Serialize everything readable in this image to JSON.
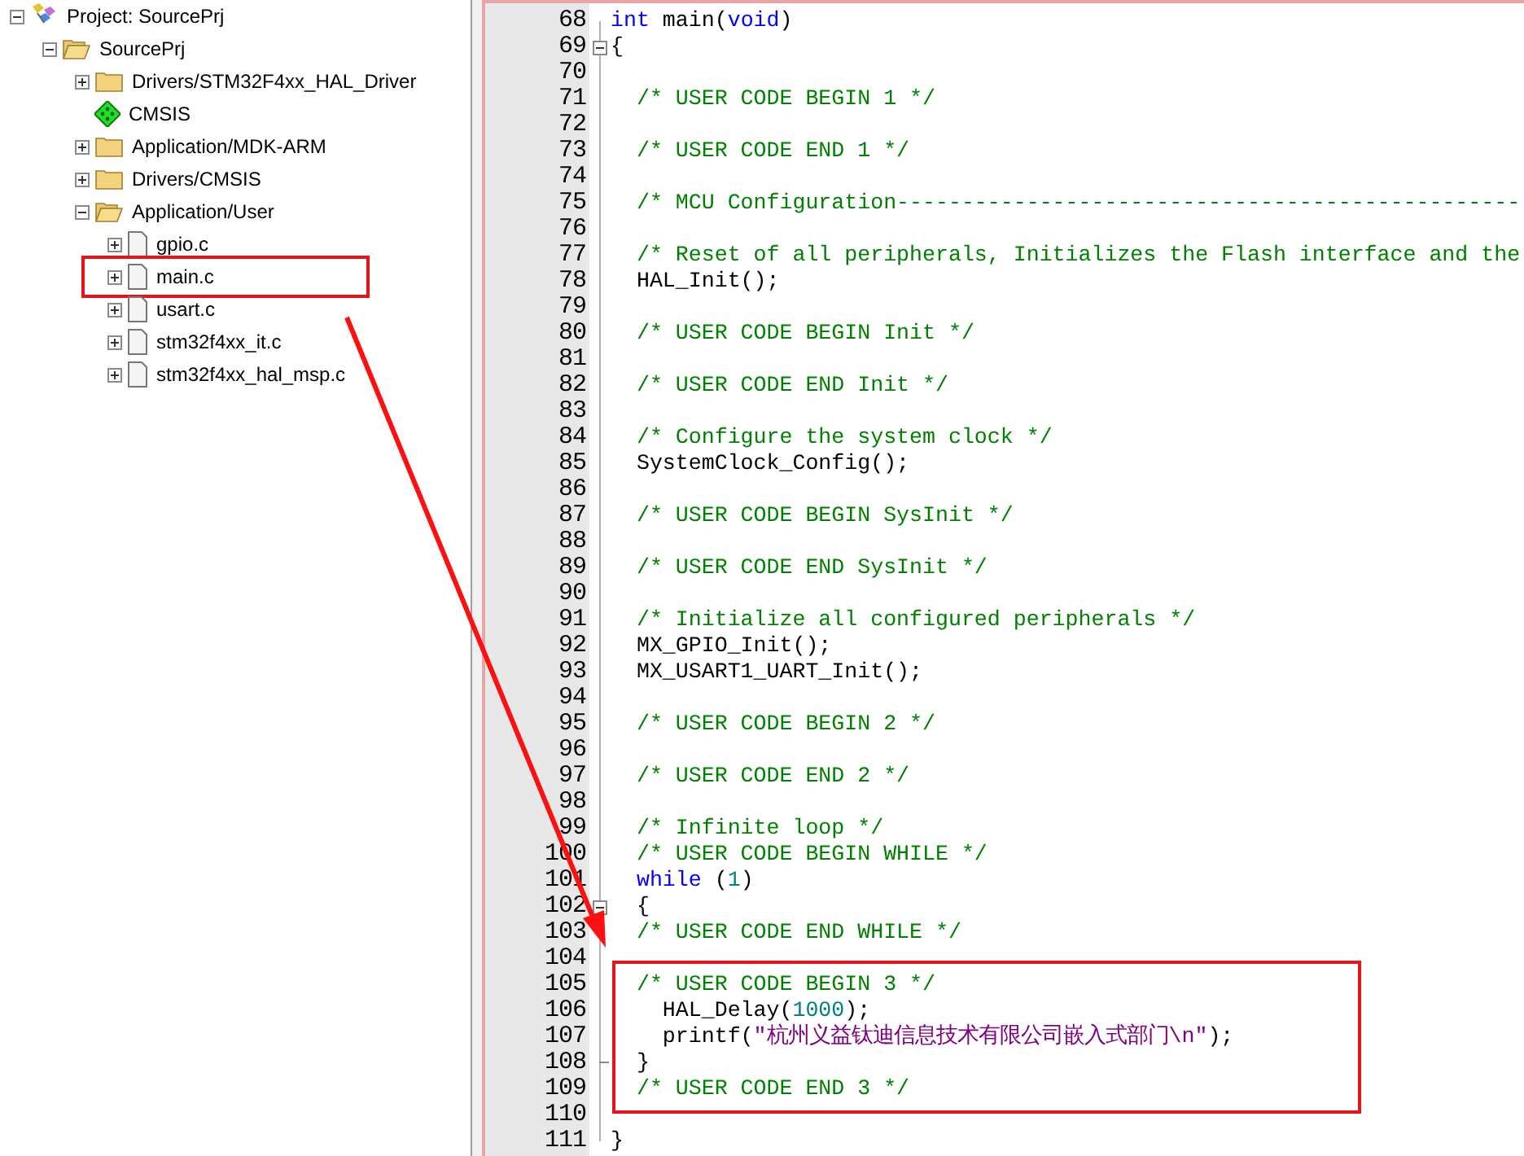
{
  "project_tree": [
    {
      "kind": "project",
      "label": "Project: SourcePrj",
      "expanded": true,
      "children": [
        {
          "kind": "target",
          "label": "SourcePrj",
          "expanded": true,
          "children": [
            {
              "kind": "folder",
              "label": "Drivers/STM32F4xx_HAL_Driver",
              "expanded": false
            },
            {
              "kind": "component",
              "label": "CMSIS"
            },
            {
              "kind": "folder",
              "label": "Application/MDK-ARM",
              "expanded": false
            },
            {
              "kind": "folder",
              "label": "Drivers/CMSIS",
              "expanded": false
            },
            {
              "kind": "folder",
              "label": "Application/User",
              "expanded": true,
              "children": [
                {
                  "kind": "file",
                  "label": "gpio.c",
                  "expanded": false,
                  "highlighted": false
                },
                {
                  "kind": "file",
                  "label": "main.c",
                  "expanded": false,
                  "highlighted": true
                },
                {
                  "kind": "file",
                  "label": "usart.c",
                  "expanded": false,
                  "highlighted": false
                },
                {
                  "kind": "file",
                  "label": "stm32f4xx_it.c",
                  "expanded": false,
                  "highlighted": false
                },
                {
                  "kind": "file",
                  "label": "stm32f4xx_hal_msp.c",
                  "expanded": false,
                  "highlighted": false
                }
              ]
            }
          ]
        }
      ]
    }
  ],
  "editor": {
    "arrow": true,
    "lines": [
      {
        "number": "68",
        "tokens": [
          {
            "kind": "keyword",
            "text": "int"
          },
          {
            "kind": "plain",
            "text": " main("
          },
          {
            "kind": "keyword",
            "text": "void"
          },
          {
            "kind": "plain",
            "text": ")"
          }
        ]
      },
      {
        "number": "69",
        "fold_start": true,
        "tokens": [
          {
            "kind": "plain",
            "text": "{"
          }
        ]
      },
      {
        "number": "70"
      },
      {
        "number": "71",
        "tokens": [
          {
            "kind": "comment",
            "text": "  /* USER CODE BEGIN 1 */"
          }
        ]
      },
      {
        "number": "72"
      },
      {
        "number": "73",
        "tokens": [
          {
            "kind": "comment",
            "text": "  /* USER CODE END 1 */"
          }
        ]
      },
      {
        "number": "74"
      },
      {
        "number": "75",
        "tokens": [
          {
            "kind": "comment",
            "text": "  /* MCU Configuration------------------------------------------------"
          }
        ]
      },
      {
        "number": "76"
      },
      {
        "number": "77",
        "tokens": [
          {
            "kind": "comment",
            "text": "  /* Reset of all peripherals, Initializes the Flash interface and the"
          }
        ]
      },
      {
        "number": "78",
        "tokens": [
          {
            "kind": "plain",
            "text": "  HAL_Init();"
          }
        ]
      },
      {
        "number": "79"
      },
      {
        "number": "80",
        "tokens": [
          {
            "kind": "comment",
            "text": "  /* USER CODE BEGIN Init */"
          }
        ]
      },
      {
        "number": "81"
      },
      {
        "number": "82",
        "tokens": [
          {
            "kind": "comment",
            "text": "  /* USER CODE END Init */"
          }
        ]
      },
      {
        "number": "83"
      },
      {
        "number": "84",
        "tokens": [
          {
            "kind": "comment",
            "text": "  /* Configure the system clock */"
          }
        ]
      },
      {
        "number": "85",
        "tokens": [
          {
            "kind": "plain",
            "text": "  SystemClock_Config();"
          }
        ]
      },
      {
        "number": "86"
      },
      {
        "number": "87",
        "tokens": [
          {
            "kind": "comment",
            "text": "  /* USER CODE BEGIN SysInit */"
          }
        ]
      },
      {
        "number": "88"
      },
      {
        "number": "89",
        "tokens": [
          {
            "kind": "comment",
            "text": "  /* USER CODE END SysInit */"
          }
        ]
      },
      {
        "number": "90"
      },
      {
        "number": "91",
        "tokens": [
          {
            "kind": "comment",
            "text": "  /* Initialize all configured peripherals */"
          }
        ]
      },
      {
        "number": "92",
        "tokens": [
          {
            "kind": "plain",
            "text": "  MX_GPIO_Init();"
          }
        ]
      },
      {
        "number": "93",
        "tokens": [
          {
            "kind": "plain",
            "text": "  MX_USART1_UART_Init();"
          }
        ]
      },
      {
        "number": "94"
      },
      {
        "number": "95",
        "tokens": [
          {
            "kind": "comment",
            "text": "  /* USER CODE BEGIN 2 */"
          }
        ]
      },
      {
        "number": "96"
      },
      {
        "number": "97",
        "tokens": [
          {
            "kind": "comment",
            "text": "  /* USER CODE END 2 */"
          }
        ]
      },
      {
        "number": "98"
      },
      {
        "number": "99",
        "tokens": [
          {
            "kind": "comment",
            "text": "  /* Infinite loop */"
          }
        ]
      },
      {
        "number": "100",
        "tokens": [
          {
            "kind": "comment",
            "text": "  /* USER CODE BEGIN WHILE */"
          }
        ]
      },
      {
        "number": "101",
        "tokens": [
          {
            "kind": "keyword",
            "text": "  while"
          },
          {
            "kind": "plain",
            "text": " ("
          },
          {
            "kind": "number",
            "text": "1"
          },
          {
            "kind": "plain",
            "text": ")"
          }
        ]
      },
      {
        "number": "102",
        "fold_start": true,
        "tokens": [
          {
            "kind": "plain",
            "text": "  {"
          }
        ]
      },
      {
        "number": "103",
        "tokens": [
          {
            "kind": "comment",
            "text": "  /* USER CODE END WHILE */"
          }
        ]
      },
      {
        "number": "104"
      },
      {
        "number": "105",
        "boxed": true,
        "tokens": [
          {
            "kind": "comment",
            "text": "  /* USER CODE BEGIN 3 */"
          }
        ]
      },
      {
        "number": "106",
        "boxed": true,
        "tokens": [
          {
            "kind": "plain",
            "text": "    HAL_Delay("
          },
          {
            "kind": "number",
            "text": "1000"
          },
          {
            "kind": "plain",
            "text": ");"
          }
        ]
      },
      {
        "number": "107",
        "boxed": true,
        "tokens": [
          {
            "kind": "plain",
            "text": "    printf("
          },
          {
            "kind": "string",
            "text": "\"杭州义益钛迪信息技术有限公司嵌入式部门\\n\""
          },
          {
            "kind": "plain",
            "text": ");"
          }
        ]
      },
      {
        "number": "108",
        "fold_end": true,
        "boxed": true,
        "tokens": [
          {
            "kind": "plain",
            "text": "  }"
          }
        ]
      },
      {
        "number": "109",
        "boxed": true,
        "tokens": [
          {
            "kind": "comment",
            "text": "  /* USER CODE END 3 */"
          }
        ]
      },
      {
        "number": "110"
      },
      {
        "number": "111",
        "tokens": [
          {
            "kind": "plain",
            "text": "}"
          }
        ]
      }
    ]
  }
}
